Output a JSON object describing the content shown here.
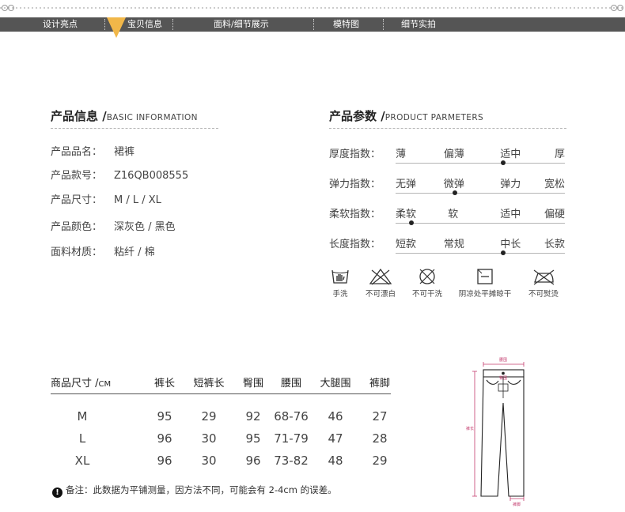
{
  "nav": {
    "tabs": [
      "设计亮点",
      "宝贝信息",
      "面料/细节展示",
      "模特图",
      "细节实拍"
    ],
    "active_index": 1,
    "active_color": "#f1b749"
  },
  "basic_info": {
    "title": "产品信息 /",
    "subtitle": "BASIC INFORMATION",
    "rows": [
      {
        "label": "产品品名：",
        "value": "裙裤"
      },
      {
        "label": "产品款号：",
        "value": "Z16QB008555"
      },
      {
        "label": "产品尺寸：",
        "value": "M / L / XL"
      },
      {
        "label": "产品颜色：",
        "value": "深灰色 / 黑色"
      },
      {
        "label": "面料材质：",
        "value": "粘纤 / 棉"
      }
    ]
  },
  "product_params": {
    "title": "产品参数 /",
    "subtitle": "PRODUCT PARMETERS",
    "rows": [
      {
        "label": "厚度指数：",
        "options": [
          "薄",
          "偏薄",
          "适中",
          "厚"
        ],
        "selected": 2
      },
      {
        "label": "弹力指数：",
        "options": [
          "无弹",
          "微弹",
          "弹力",
          "宽松"
        ],
        "selected": 1
      },
      {
        "label": "柔软指数：",
        "options": [
          "柔软",
          "软",
          "适中",
          "偏硬"
        ],
        "selected": 0
      },
      {
        "label": "长度指数：",
        "options": [
          "短款",
          "常规",
          "中长",
          "长款"
        ],
        "selected": 2
      }
    ]
  },
  "care": [
    {
      "icon": "hand-wash-icon",
      "label": "手洗"
    },
    {
      "icon": "no-bleach-icon",
      "label": "不可漂白"
    },
    {
      "icon": "no-tumble-dry-icon",
      "label": "不可干洗"
    },
    {
      "icon": "shade-flat-dry-icon",
      "label": "阴凉处平摊晾干"
    },
    {
      "icon": "no-iron-icon",
      "label": "不可熨烫"
    }
  ],
  "size_table": {
    "title": "商品尺寸 /",
    "unit": "CM",
    "headers": [
      "裤长",
      "短裤长",
      "臀围",
      "腰围",
      "大腿围",
      "裤脚"
    ],
    "rows": [
      {
        "size": "M",
        "values": [
          "95",
          "29",
          "92",
          "68-76",
          "46",
          "27"
        ]
      },
      {
        "size": "L",
        "values": [
          "96",
          "30",
          "95",
          "71-79",
          "47",
          "28"
        ]
      },
      {
        "size": "XL",
        "values": [
          "96",
          "30",
          "96",
          "73-82",
          "48",
          "29"
        ]
      }
    ],
    "note": "备注：此数据为平铺测量，因方法不同，可能会有 2-4cm 的误差。"
  },
  "diagram": {
    "labels": [
      "腰围",
      "臀围",
      "裤长",
      "裤脚"
    ],
    "accent": "#c43c6e"
  }
}
